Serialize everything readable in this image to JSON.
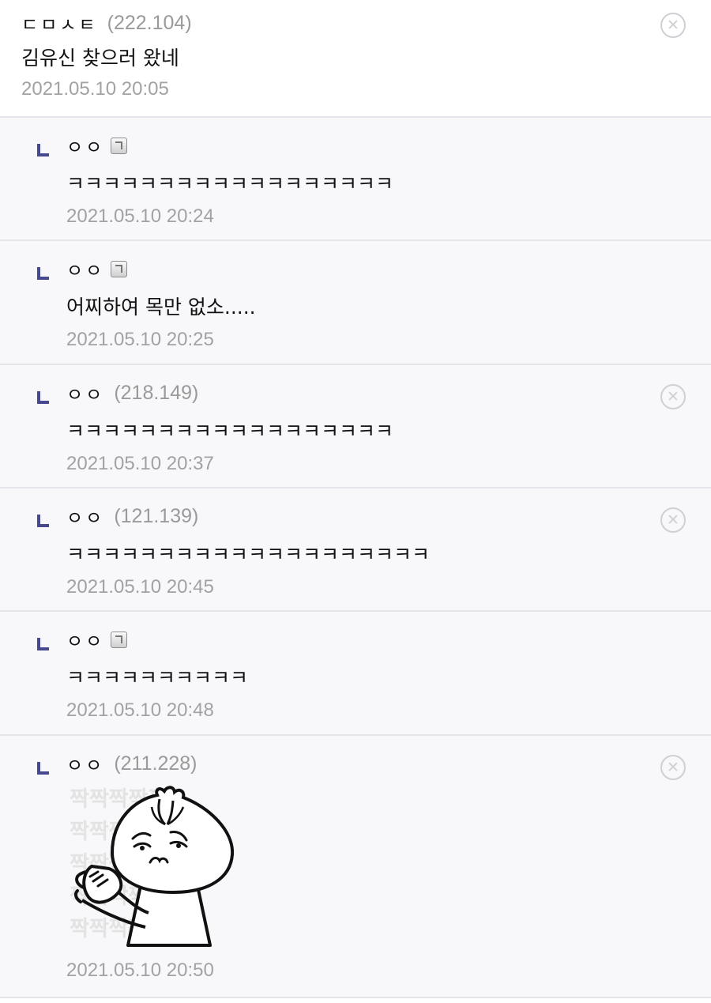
{
  "comments": [
    {
      "nick": "ㄷㅁㅅㅌ",
      "ip": "(222.104)",
      "text": "김유신 찾으러 왔네",
      "date": "2021.05.10 20:05"
    },
    {
      "nick": "ㅇㅇ",
      "text": "ㅋㅋㅋㅋㅋㅋㅋㅋㅋㅋㅋㅋㅋㅋㅋㅋㅋㅋ",
      "date": "2021.05.10 20:24"
    },
    {
      "nick": "ㅇㅇ",
      "text": "어찌하여 목만 없소.....",
      "date": "2021.05.10 20:25"
    },
    {
      "nick": "ㅇㅇ",
      "ip": "(218.149)",
      "text": "ㅋㅋㅋㅋㅋㅋㅋㅋㅋㅋㅋㅋㅋㅋㅋㅋㅋㅋ",
      "date": "2021.05.10 20:37"
    },
    {
      "nick": "ㅇㅇ",
      "ip": "(121.139)",
      "text": "ㅋㅋㅋㅋㅋㅋㅋㅋㅋㅋㅋㅋㅋㅋㅋㅋㅋㅋㅋㅋ",
      "date": "2021.05.10 20:45"
    },
    {
      "nick": "ㅇㅇ",
      "text": "ㅋㅋㅋㅋㅋㅋㅋㅋㅋㅋ",
      "date": "2021.05.10 20:48"
    },
    {
      "nick": "ㅇㅇ",
      "ip": "(211.228)",
      "sticker_text": "짝짝짝짝짝\n짝짝짝짝짝\n짝짝짝짝짝\n짝짝짝짝짝\n짝짝짝짝짝",
      "date": "2021.05.10 20:50"
    }
  ],
  "icons": {
    "delete": "close-circle-icon",
    "fixed_user": "fixed-user-badge-icon",
    "reply": "reply-arrow-icon"
  },
  "colors": {
    "reply_mark": "#46498f",
    "reply_bg": "#f8f8fa",
    "meta_text": "#a2a2a2"
  }
}
